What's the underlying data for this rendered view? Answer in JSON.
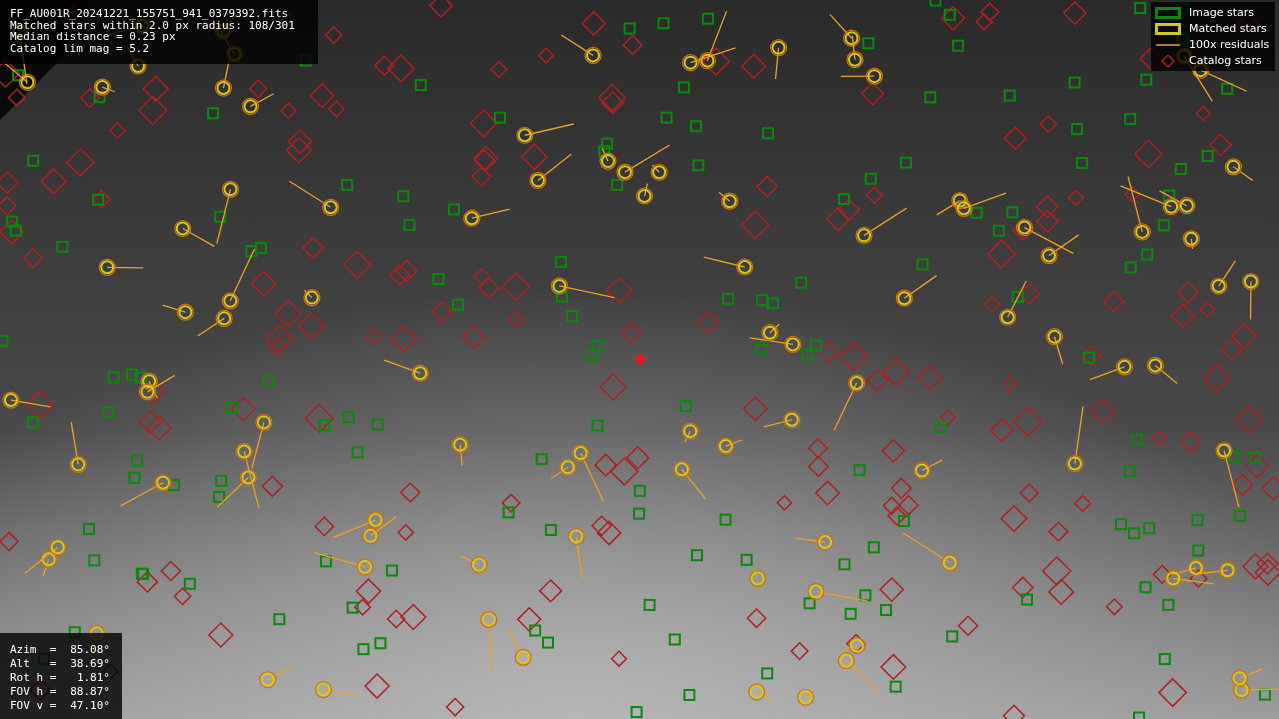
{
  "info_lines": [
    "FF_AU001R_20241221_155751_941_0379392.fits",
    "Matched stars within 2.0 px radius: 108/301",
    "Median distance = 0.23 px",
    "Catalog lim mag = 5.2"
  ],
  "legend": [
    {
      "kind": "image",
      "label": "Image stars"
    },
    {
      "kind": "matched",
      "label": "Matched stars"
    },
    {
      "kind": "residual",
      "label": "100x residuals"
    },
    {
      "kind": "catalog",
      "label": "Catalog stars"
    }
  ],
  "pointing": [
    {
      "label": "Azim  =",
      "value": "85.08°"
    },
    {
      "label": "Alt   =",
      "value": "38.69°"
    },
    {
      "label": "Rot h =",
      "value": "1.81°"
    },
    {
      "label": "FOV h =",
      "value": "88.87°"
    },
    {
      "label": "FOV v =",
      "value": "47.10°"
    }
  ]
}
